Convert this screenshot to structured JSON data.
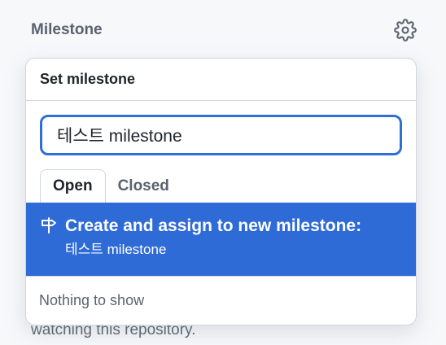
{
  "sidebar": {
    "heading": "Milestone",
    "gear_icon": "gear-icon",
    "behind_text": "watching this repository."
  },
  "popover": {
    "title": "Set milestone",
    "filter": {
      "value": "테스트 milestone",
      "placeholder": "Filter milestones"
    },
    "tabs": [
      {
        "label": "Open",
        "selected": true
      },
      {
        "label": "Closed",
        "selected": false
      }
    ],
    "create_item": {
      "icon": "milestone-icon",
      "title": "Create and assign to new milestone:",
      "name": "테스트 milestone",
      "highlight_color": "#2f6bd6"
    },
    "empty_message": "Nothing to show"
  }
}
